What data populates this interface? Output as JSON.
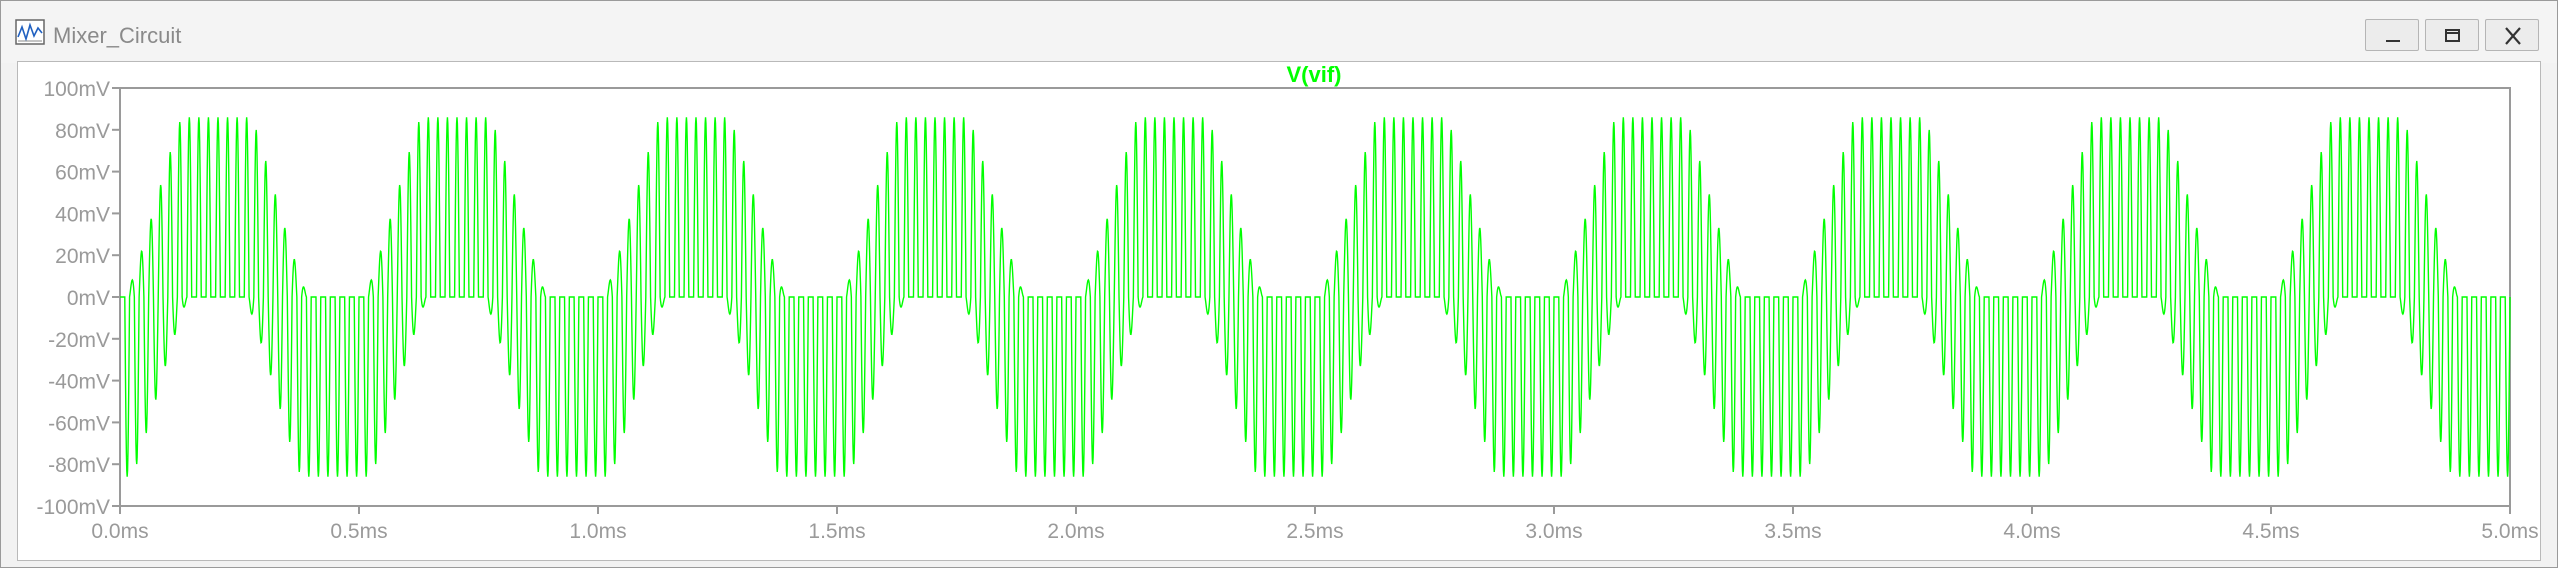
{
  "window": {
    "title": "Mixer_Circuit",
    "controls": {
      "minimize": "minimize-icon",
      "restore": "restore-icon",
      "close": "close-icon"
    }
  },
  "plot": {
    "trace_label": "V(vif)",
    "trace_color": "#00ff00",
    "y_ticks": [
      "100mV",
      "80mV",
      "60mV",
      "40mV",
      "20mV",
      "0mV",
      "-20mV",
      "-40mV",
      "-60mV",
      "-80mV",
      "-100mV"
    ],
    "x_ticks": [
      "0.0ms",
      "0.5ms",
      "1.0ms",
      "1.5ms",
      "2.0ms",
      "2.5ms",
      "3.0ms",
      "3.5ms",
      "4.0ms",
      "4.5ms",
      "5.0ms"
    ],
    "axis_color": "#9a9a9a"
  },
  "chart_data": {
    "type": "line",
    "series": [
      {
        "name": "V(vif)",
        "description_values": {
          "envelope_peak_mV": 86,
          "envelope_min_mV": -86,
          "envelope_period_ms": 0.5,
          "envelope_cycles": 10,
          "carrier_cycles_per_envelope_cycle": 25
        }
      }
    ],
    "title": "V(vif)",
    "xlabel": "",
    "ylabel": "",
    "xlim": [
      0,
      5
    ],
    "ylim": [
      -100,
      100
    ],
    "x_unit": "ms",
    "y_unit": "mV",
    "grid": false
  }
}
